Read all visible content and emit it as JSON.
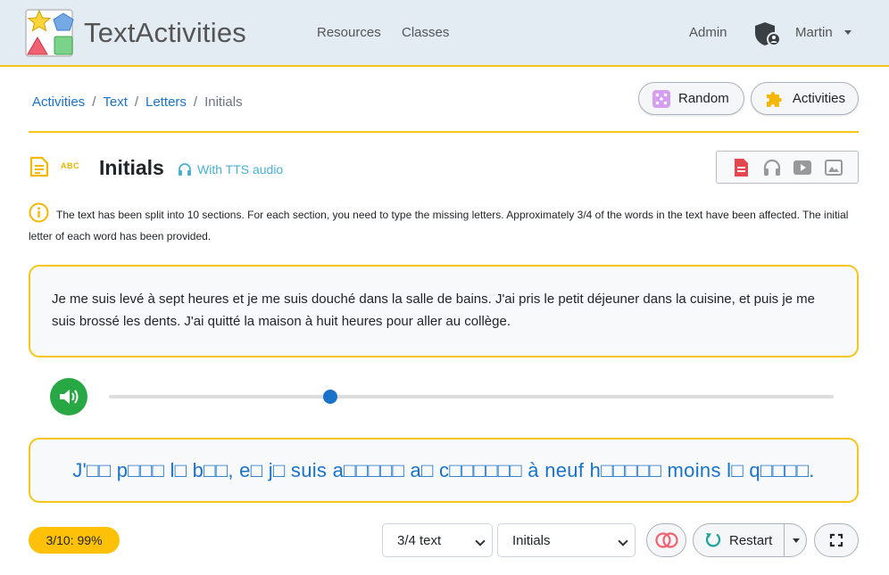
{
  "app": {
    "brand": "TextActivities"
  },
  "nav": {
    "resources": "Resources",
    "classes": "Classes",
    "admin": "Admin",
    "user": "Martin"
  },
  "breadcrumb": {
    "items": [
      "Activities",
      "Text",
      "Letters"
    ],
    "current": "Initials",
    "sep": "/"
  },
  "buttons": {
    "random": "Random",
    "activities": "Activities",
    "restart": "Restart"
  },
  "activity": {
    "badge": "ABC",
    "title": "Initials",
    "tts": "With TTS audio",
    "info": "The text has been split into 10 sections. For each section, you need to type the missing letters. Approximately 3/4 of the words in the text have been affected. The initial letter of each word has been provided.",
    "text": "Je me suis levé à sept heures et je me suis douché dans la salle de bains. J'ai pris le petit déjeuner dans la cuisine, et puis je me suis brossé les dents. J'ai quitté la maison à huit heures pour aller au collège.",
    "answer": "J'□□ p□□□ l□ b□□, e□ j□ suis a□□□□□ a□ c□□□□□□ à neuf h□□□□□ moins l□ q□□□□."
  },
  "audio": {
    "progress_percent": 30.5
  },
  "footer": {
    "score": "3/10: 99%",
    "ratio_select": "3/4 text",
    "mode_select": "Initials"
  },
  "colors": {
    "accent": "#f5c518",
    "link": "#1a73c9",
    "play": "#28a745",
    "score": "#ffc107"
  }
}
